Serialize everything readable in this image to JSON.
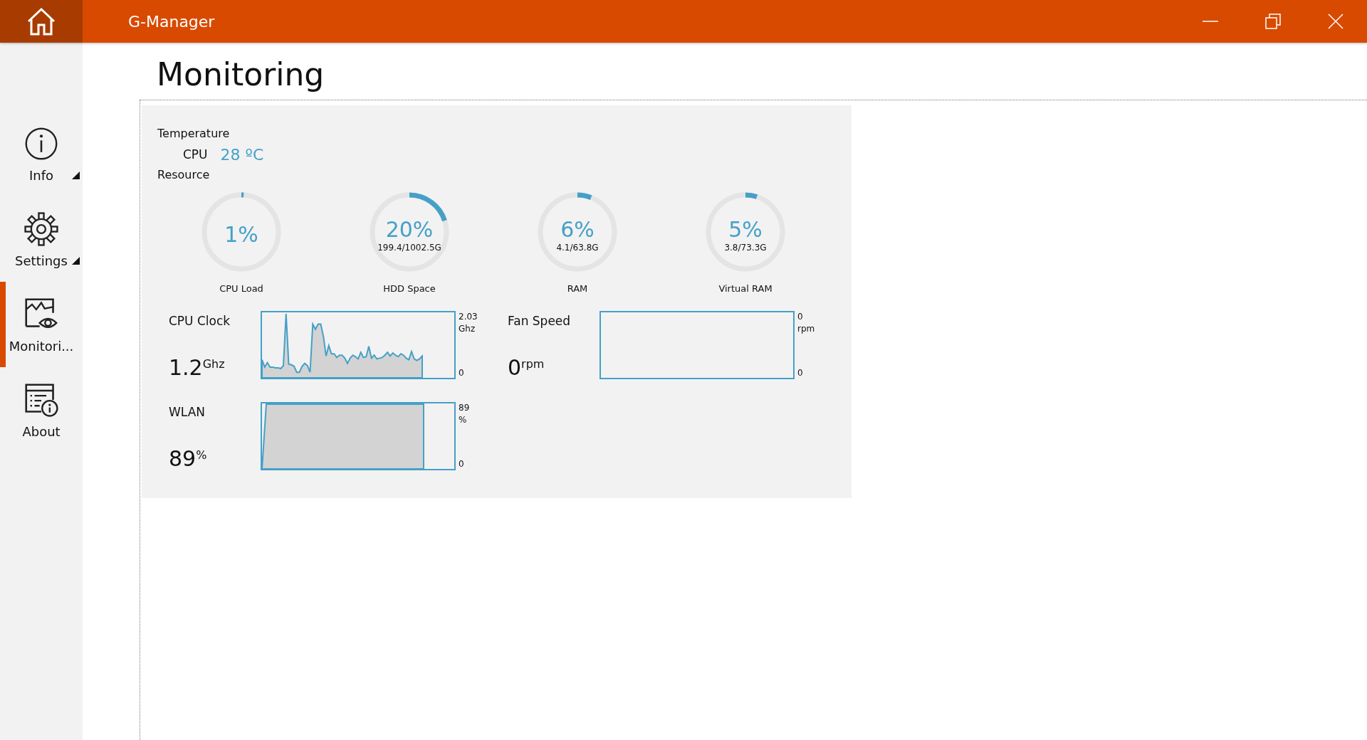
{
  "window": {
    "title": "G-Manager"
  },
  "sidebar": {
    "items": [
      {
        "kind": "info",
        "label": "Info",
        "has_submenu": true,
        "selected": false
      },
      {
        "kind": "settings",
        "label": "Settings",
        "has_submenu": true,
        "selected": false
      },
      {
        "kind": "monitoring",
        "label": "Monitori...",
        "has_submenu": false,
        "selected": true
      },
      {
        "kind": "about",
        "label": "About",
        "has_submenu": false,
        "selected": false
      }
    ]
  },
  "page": {
    "heading": "Monitoring"
  },
  "temperature": {
    "title": "Temperature",
    "sensor": "CPU",
    "reading": "28 ºC"
  },
  "resource": {
    "title": "Resource",
    "gauges": [
      {
        "percent": "1%",
        "label": "CPU Load",
        "level": 0.01
      },
      {
        "percent": "20%",
        "detail": "199.4/1002.5G",
        "label": "HDD Space",
        "level": 0.2
      },
      {
        "percent": "6%",
        "detail": "4.1/63.8G",
        "label": "RAM",
        "level": 0.06
      },
      {
        "percent": "5%",
        "detail": "3.8/73.3G",
        "label": "Virtual RAM",
        "level": 0.05
      }
    ]
  },
  "graphs": [
    {
      "kind": "cpu_clock",
      "title": "CPU Clock",
      "value": "1.2",
      "unit": "Ghz",
      "axis_max": "2.03",
      "axis_unit": "Ghz",
      "axis_min": "0"
    },
    {
      "kind": "fan_speed",
      "title": "Fan Speed",
      "value": "0",
      "unit": "rpm",
      "axis_max": "0",
      "axis_unit": "rpm",
      "axis_min": "0"
    },
    {
      "kind": "wlan",
      "title": "WLAN",
      "value": "89",
      "unit": "%",
      "axis_max": "89",
      "axis_unit": "%",
      "axis_min": "0"
    }
  ]
}
